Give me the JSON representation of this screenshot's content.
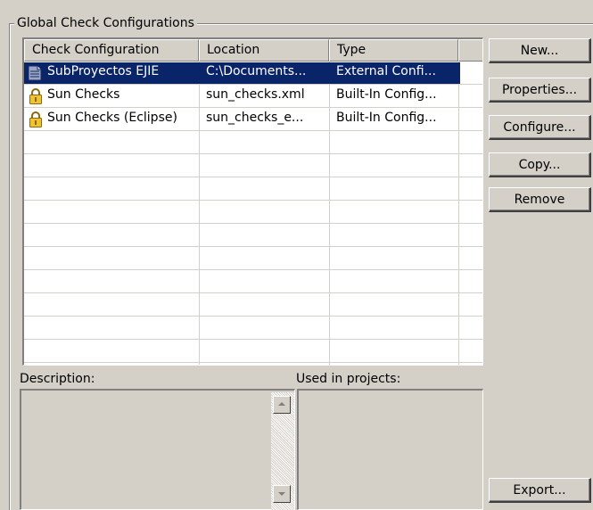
{
  "group": {
    "title": "Global Check Configurations"
  },
  "table": {
    "columns": [
      "Check Configuration",
      "Location",
      "Type"
    ],
    "rows": [
      {
        "name": "SubProyectos EJIE",
        "location": "C:\\Documents...",
        "type": "External Confi...",
        "icon": "document-icon",
        "selected": true
      },
      {
        "name": "Sun Checks",
        "location": "sun_checks.xml",
        "type": "Built-In Config...",
        "icon": "lock-icon",
        "selected": false
      },
      {
        "name": "Sun Checks (Eclipse)",
        "location": "sun_checks_e...",
        "type": "Built-In Config...",
        "icon": "lock-icon",
        "selected": false
      }
    ]
  },
  "buttons": {
    "new_label": "New...",
    "properties_label": "Properties...",
    "configure_label": "Configure...",
    "copy_label": "Copy...",
    "remove_label": "Remove",
    "export_label": "Export..."
  },
  "description": {
    "label": "Description:",
    "value": ""
  },
  "used_in_projects": {
    "label": "Used in projects:"
  },
  "colors": {
    "selection": "#0a246a",
    "background": "#d4d0c8"
  }
}
